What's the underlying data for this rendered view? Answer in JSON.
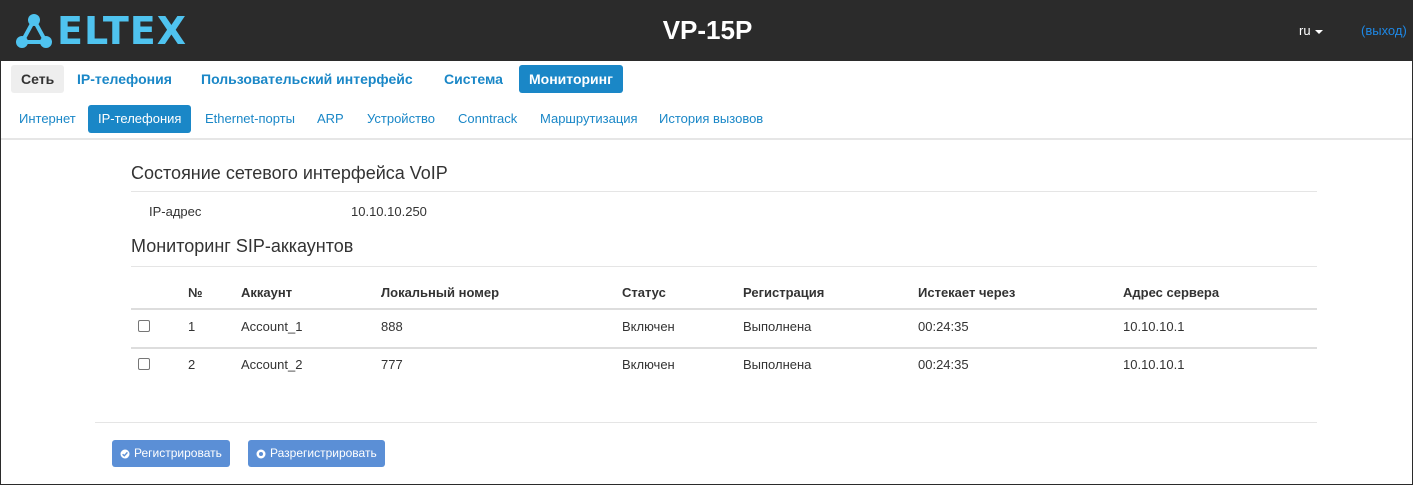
{
  "header": {
    "logo_text": "ELTEX",
    "device_title": "VP-15P",
    "lang": "ru",
    "logout": "(выход)"
  },
  "main_nav": [
    {
      "label": "Сеть"
    },
    {
      "label": "IP-телефония"
    },
    {
      "label": "Пользовательский интерфейс"
    },
    {
      "label": "Система"
    },
    {
      "label": "Мониторинг",
      "active": true
    }
  ],
  "sub_nav": [
    {
      "label": "Интернет"
    },
    {
      "label": "IP-телефония",
      "active": true
    },
    {
      "label": "Ethernet-порты"
    },
    {
      "label": "ARP"
    },
    {
      "label": "Устройство"
    },
    {
      "label": "Conntrack"
    },
    {
      "label": "Маршрутизация"
    },
    {
      "label": "История вызовов"
    }
  ],
  "voip_section": {
    "title": "Состояние сетевого интерфейса VoIP",
    "ip_label": "IP-адрес",
    "ip_value": "10.10.10.250"
  },
  "sip_section": {
    "title": "Мониторинг SIP-аккаунтов",
    "columns": [
      "№",
      "Аккаунт",
      "Локальный номер",
      "Статус",
      "Регистрация",
      "Истекает через",
      "Адрес сервера"
    ],
    "rows": [
      {
        "num": "1",
        "account": "Account_1",
        "local": "888",
        "status": "Включен",
        "registration": "Выполнена",
        "expires": "00:24:35",
        "server": "10.10.10.1",
        "checked": false
      },
      {
        "num": "2",
        "account": "Account_2",
        "local": "777",
        "status": "Включен",
        "registration": "Выполнена",
        "expires": "00:24:35",
        "server": "10.10.10.1",
        "checked": false
      }
    ]
  },
  "buttons": {
    "register": "Регистрировать",
    "unregister": "Разрегистрировать"
  },
  "colors": {
    "topbar": "#2b2b2b",
    "brand": "#4fc3ef",
    "accent": "#1a87c7",
    "button": "#5b8fd6"
  }
}
